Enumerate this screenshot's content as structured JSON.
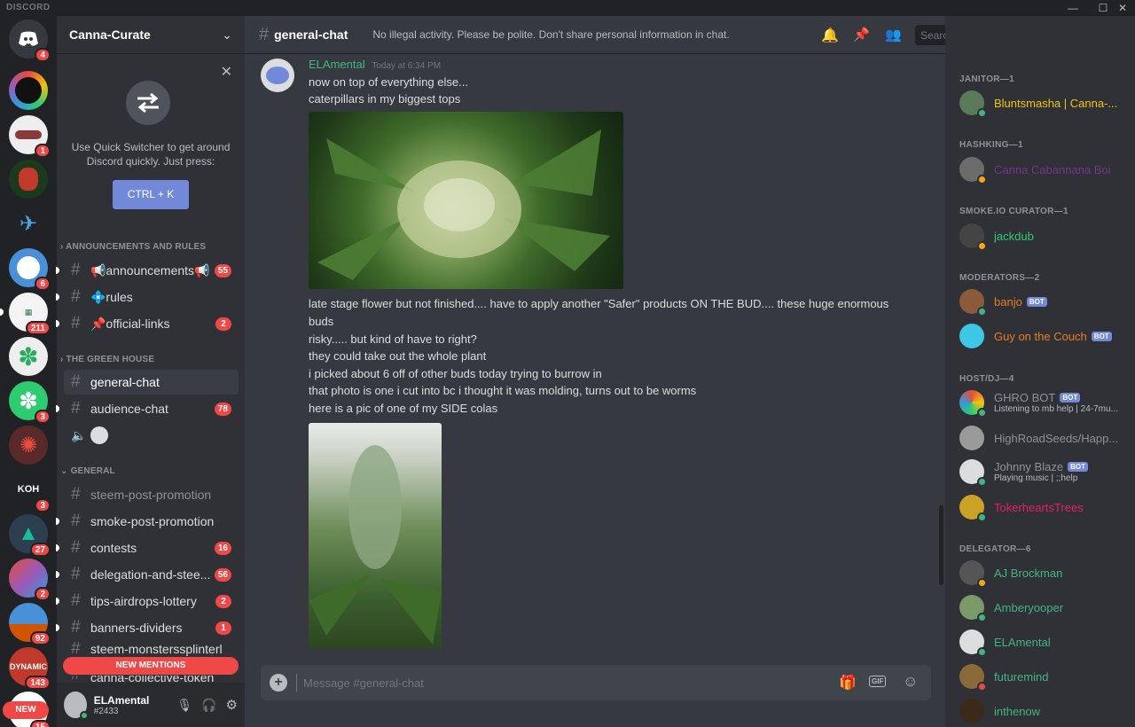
{
  "app": {
    "brand": "DISCORD"
  },
  "server": {
    "name": "Canna-Curate"
  },
  "guilds": [
    {
      "badge": "4"
    },
    {
      "badge": ""
    },
    {
      "badge": "1"
    },
    {
      "badge": ""
    },
    {
      "badge": ""
    },
    {
      "badge": "6"
    },
    {
      "badge": "211"
    },
    {
      "badge": ""
    },
    {
      "badge": "3"
    },
    {
      "badge": ""
    },
    {
      "badge": "3",
      "label": "KOH"
    },
    {
      "badge": "27"
    },
    {
      "badge": "2"
    },
    {
      "badge": "92"
    },
    {
      "badge": "143"
    },
    {
      "badge": "15",
      "label": "NEW"
    }
  ],
  "quick_switcher": {
    "text": "Use Quick Switcher to get around Discord quickly. Just press:",
    "button": "CTRL + K"
  },
  "categories": {
    "announcements": "ANNOUNCEMENTS AND RULES",
    "green_house": "THE GREEN HOUSE",
    "general": "GENERAL"
  },
  "channels": [
    {
      "name": "📢announcements📢",
      "badge": "55"
    },
    {
      "name": "💠rules",
      "badge": ""
    },
    {
      "name": "📌official-links",
      "badge": "2"
    },
    {
      "name": "general-chat",
      "badge": ""
    },
    {
      "name": "audience-chat",
      "badge": "78"
    },
    {
      "name": "steem-post-promotion",
      "badge": ""
    },
    {
      "name": "smoke-post-promotion",
      "badge": ""
    },
    {
      "name": "contests",
      "badge": "16"
    },
    {
      "name": "delegation-and-stee...",
      "badge": "56"
    },
    {
      "name": "tips-airdrops-lottery",
      "badge": "2"
    },
    {
      "name": "banners-dividers",
      "badge": "1"
    },
    {
      "name": "steem-monsterssplinterl",
      "badge": ""
    },
    {
      "name": "canna-collective-token",
      "badge": ""
    }
  ],
  "new_mentions": "NEW MENTIONS",
  "user": {
    "name": "ELAmental",
    "tag": "#2433"
  },
  "channel_header": {
    "name": "general-chat",
    "topic": "No illegal activity. Please be polite. Don't share personal information in chat."
  },
  "search": {
    "placeholder": "Search"
  },
  "message": {
    "author": "ELAmental",
    "timestamp": "Today at 6:34 PM",
    "lines_a": [
      "now on top of everything else...",
      "caterpillars in my biggest tops"
    ],
    "lines_b": [
      "late stage flower but not finished.... have to apply another \"Safer\" products ON THE BUD.... these huge enormous",
      "buds",
      "risky..... but kind of have to right?",
      "they could take out the whole plant",
      "i picked about 6 off of other buds today trying to burrow in",
      "that photo is one i cut into bc i thought it was molding, turns out to be worms",
      "here is a pic of one of my SIDE colas"
    ]
  },
  "composer": {
    "placeholder": "Message #general-chat"
  },
  "roles": [
    {
      "title": "JANITOR—1"
    },
    {
      "title": "HASHKING—1"
    },
    {
      "title": "SMOKE.IO CURATOR—1"
    },
    {
      "title": "MODERATORS—2"
    },
    {
      "title": "HOST/DJ—4"
    },
    {
      "title": "DELEGATOR—6"
    }
  ],
  "members": [
    {
      "name": "Bluntsmasha | Canna-...",
      "color": "#f1c40f"
    },
    {
      "name": "Canna Cabannana Boi",
      "color": "#71368a"
    },
    {
      "name": "jackdub",
      "color": "#2ecc71"
    },
    {
      "name": "banjo",
      "color": "#e67e22",
      "bot": "BOT"
    },
    {
      "name": "Guy on the Couch",
      "color": "#e67e22",
      "bot": "BOT"
    },
    {
      "name": "GHRO BOT",
      "color": "#8e9297",
      "bot": "BOT",
      "activity": "Listening to mb help | 24-7mu..."
    },
    {
      "name": "HighRoadSeeds/Happ...",
      "color": "#8e9297"
    },
    {
      "name": "Johnny Blaze",
      "color": "#8e9297",
      "bot": "BOT",
      "activity": "Playing music | ;;help"
    },
    {
      "name": "TokerheartsTrees",
      "color": "#e91e63"
    },
    {
      "name": "AJ Brockman",
      "color": "#43b581"
    },
    {
      "name": "Amberyooper",
      "color": "#43b581"
    },
    {
      "name": "ELAmental",
      "color": "#43b581"
    },
    {
      "name": "futuremind",
      "color": "#43b581"
    },
    {
      "name": "inthenow",
      "color": "#43b581"
    }
  ]
}
